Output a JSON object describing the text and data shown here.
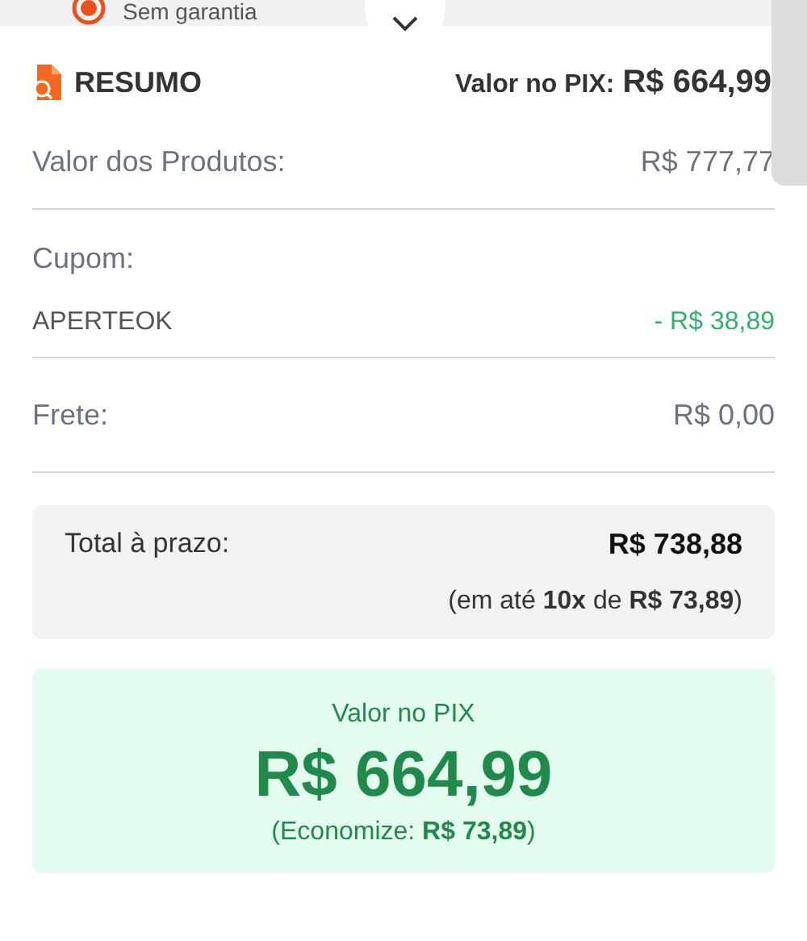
{
  "background_option": {
    "label": "Sem garantia",
    "selected": true
  },
  "summary": {
    "title": "RESUMO",
    "pix_label": "Valor no PIX:",
    "pix_value": "R$ 664,99",
    "rows": [
      {
        "kind": "line",
        "label": "Valor dos Produtos:",
        "value": "R$ 777,77"
      },
      {
        "kind": "coupon",
        "label": "Cupom:",
        "code": "APERTEOK",
        "value": "- R$ 38,89"
      },
      {
        "kind": "line",
        "label": "Frete:",
        "value": "R$ 0,00"
      }
    ],
    "installment": {
      "label": "Total à prazo:",
      "value": "R$ 738,88",
      "detail": "(em até **10x** de **R$ 73,89**)"
    },
    "pix": {
      "label": "Valor no PIX",
      "value": "R$ 664,99",
      "savings": "(Economize: **R$ 73,89**)"
    }
  }
}
